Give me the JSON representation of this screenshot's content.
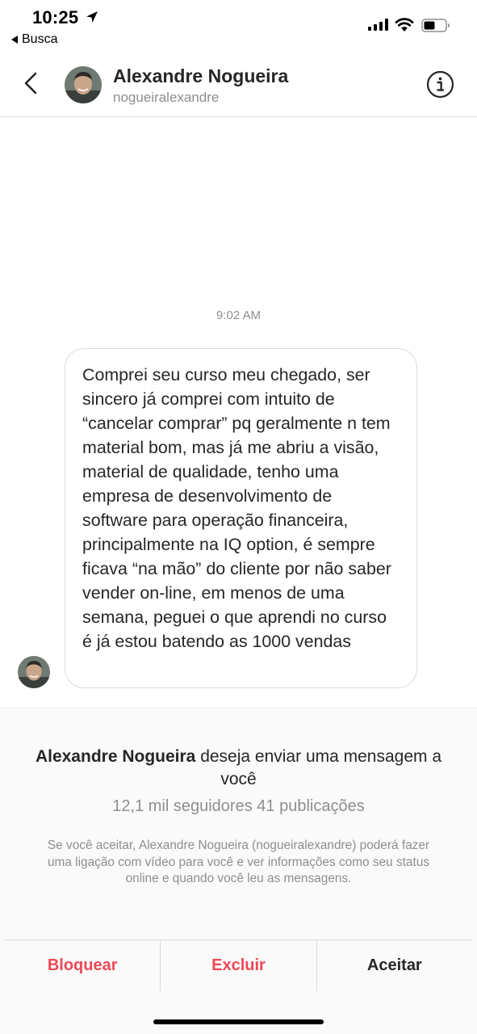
{
  "status_bar": {
    "time": "10:25",
    "back_app": "Busca",
    "icons": [
      "location-arrow-icon",
      "signal-icon",
      "wifi-icon",
      "battery-icon"
    ]
  },
  "header": {
    "name": "Alexandre Nogueira",
    "username": "nogueiralexandre",
    "icons": [
      "back-chevron-icon",
      "info-icon"
    ]
  },
  "conversation": {
    "timestamp": "9:02 AM",
    "message": "Comprei seu curso meu chegado, ser sincero já comprei com intuito de “cancelar comprar” pq geralmente n tem material bom, mas já me abriu a visão, material de qualidade, tenho uma empresa de desenvolvimento de software para operação financeira, principalmente na IQ option, é sempre ficava “na mão” do cliente por não saber vender on-line, em menos de uma semana, peguei o que aprendi no curso é já estou batendo as 1000 vendas"
  },
  "request": {
    "sender": "Alexandre Nogueira",
    "title_rest": " deseja enviar uma mensagem a você",
    "stats": "12,1 mil seguidores 41 publicações",
    "note": "Se você aceitar, Alexandre Nogueira (nogueiralexandre) poderá fazer uma ligação com vídeo para você e ver informações como seu status online e quando você leu as mensagens."
  },
  "actions": {
    "block": "Bloquear",
    "delete": "Excluir",
    "accept": "Aceitar"
  },
  "colors": {
    "destructive": "#ed4956",
    "primary_text": "#262626",
    "secondary_text": "#8e8e8e",
    "divider": "#dbdbdb"
  }
}
